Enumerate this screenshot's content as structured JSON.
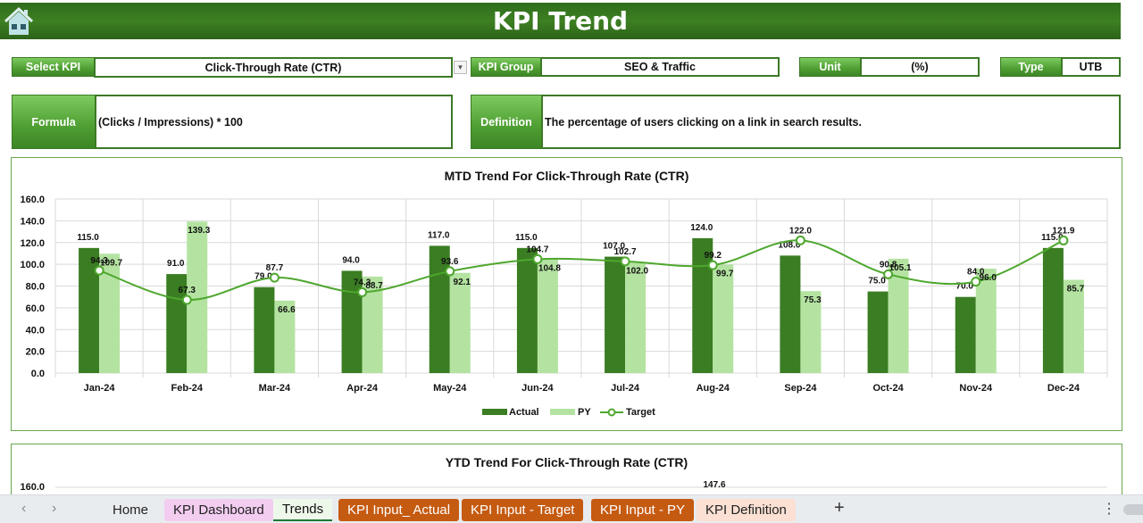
{
  "header": {
    "title": "KPI Trend",
    "home_icon": "home-icon"
  },
  "filters": {
    "select_kpi_label": "Select KPI",
    "select_kpi_value": "Click-Through Rate (CTR)",
    "kpi_group_label": "KPI Group",
    "kpi_group_value": "SEO & Traffic",
    "unit_label": "Unit",
    "unit_value": "(%)",
    "type_label": "Type",
    "type_value": "UTB"
  },
  "info": {
    "formula_label": "Formula",
    "formula_value": "(Clicks / Impressions) * 100",
    "definition_label": "Definition",
    "definition_value": "The percentage of users clicking on a link in search results."
  },
  "chart_data": [
    {
      "type": "bar",
      "title": "MTD Trend For Click-Through Rate (CTR)",
      "xlabel": "",
      "ylabel": "",
      "ylim": [
        0,
        160
      ],
      "yticks": [
        "0.0",
        "20.0",
        "40.0",
        "60.0",
        "80.0",
        "100.0",
        "120.0",
        "140.0",
        "160.0"
      ],
      "grid": true,
      "legend": "bottom",
      "categories": [
        "Jan-24",
        "Feb-24",
        "Mar-24",
        "Apr-24",
        "May-24",
        "Jun-24",
        "Jul-24",
        "Aug-24",
        "Sep-24",
        "Oct-24",
        "Nov-24",
        "Dec-24"
      ],
      "series": [
        {
          "name": "Actual",
          "kind": "bar",
          "color": "#3a7d22",
          "values": [
            115.0,
            91.0,
            79.0,
            94.0,
            117.0,
            115.0,
            107.0,
            124.0,
            108.0,
            75.0,
            70.0,
            115.0
          ]
        },
        {
          "name": "PY",
          "kind": "bar",
          "color": "#b4e3a1",
          "values": [
            109.7,
            139.3,
            66.6,
            88.7,
            92.1,
            104.8,
            102.0,
            99.7,
            75.3,
            105.1,
            96.0,
            85.7
          ]
        },
        {
          "name": "Target",
          "kind": "line",
          "color": "#4ea72e",
          "values": [
            94.3,
            67.3,
            87.7,
            74.3,
            93.6,
            104.7,
            102.7,
            99.2,
            122.0,
            90.8,
            84.0,
            121.9
          ]
        }
      ]
    },
    {
      "type": "bar",
      "title": "YTD Trend For Click-Through Rate (CTR)",
      "ylim": [
        0,
        160
      ],
      "yticks": [
        "160.0"
      ],
      "visible_labels": [
        "147.6"
      ]
    }
  ],
  "tabs": {
    "prev": "‹",
    "next": "›",
    "items": [
      {
        "label": "Home",
        "bg": "transparent",
        "color": "#222"
      },
      {
        "label": "KPI Dashboard",
        "bg": "#f2cdf0",
        "color": "#222"
      },
      {
        "label": "Trends",
        "bg": "#eef8ea",
        "color": "#111",
        "active": true
      },
      {
        "label": "KPI Input_ Actual",
        "bg": "#c55a11",
        "color": "#ffffff"
      },
      {
        "label": "KPI Input - Target",
        "bg": "#c55a11",
        "color": "#ffffff"
      },
      {
        "label": "KPI Input - PY",
        "bg": "#c55a11",
        "color": "#ffffff"
      },
      {
        "label": "KPI Definition",
        "bg": "#fbe0d3",
        "color": "#222"
      }
    ],
    "add": "+",
    "more": "⋮"
  }
}
